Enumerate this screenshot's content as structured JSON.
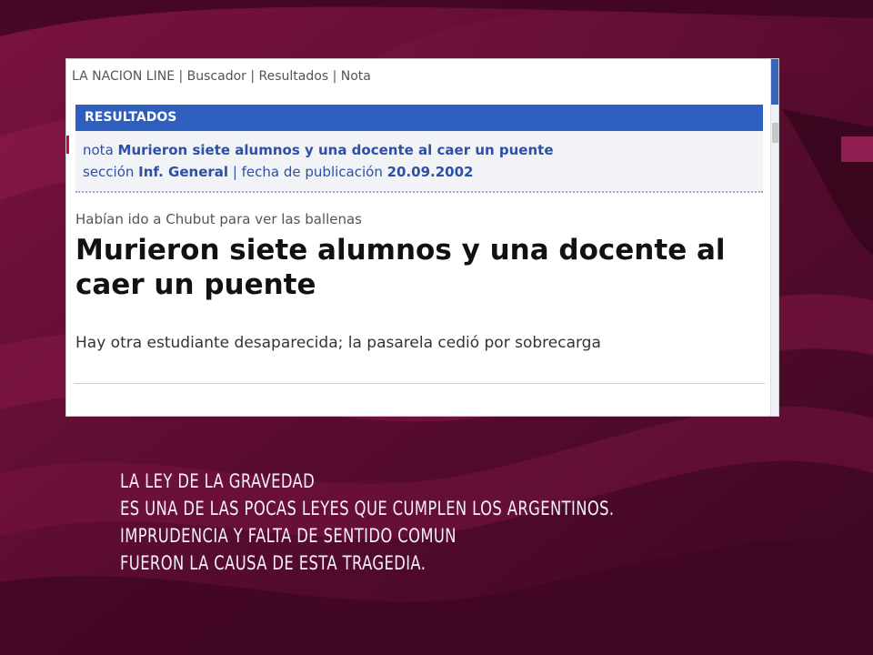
{
  "browser": {
    "breadcrumb": "LA NACION LINE | Buscador | Resultados | Nota",
    "results_header": "RESULTADOS",
    "result": {
      "nota_prefix": "nota ",
      "nota_title": "Murieron siete alumnos y una docente al caer un puente",
      "seccion_prefix": "sección ",
      "seccion_value": "Inf. General",
      "separator": " | ",
      "fecha_prefix": "fecha de publicación ",
      "fecha_value": "20.09.2002"
    },
    "article": {
      "kicker": "Habían ido a Chubut para ver las ballenas",
      "headline": "Murieron siete alumnos y una docente al caer un puente",
      "dek": "Hay otra estudiante desaparecida; la pasarela cedió por sobrecarga"
    }
  },
  "caption": {
    "lines": [
      "LA LEY DE LA GRAVEDAD",
      "ES UNA DE LAS POCAS LEYES QUE CUMPLEN LOS ARGENTINOS.",
      "IMPRUDENCIA  Y FALTA  DE SENTIDO COMUN",
      "FUERON LA CAUSA DE ESTA TRAGEDIA."
    ]
  },
  "colors": {
    "background": "#4a0a28",
    "results_bar": "#2e5fbf",
    "link_blue": "#2b50a8"
  }
}
